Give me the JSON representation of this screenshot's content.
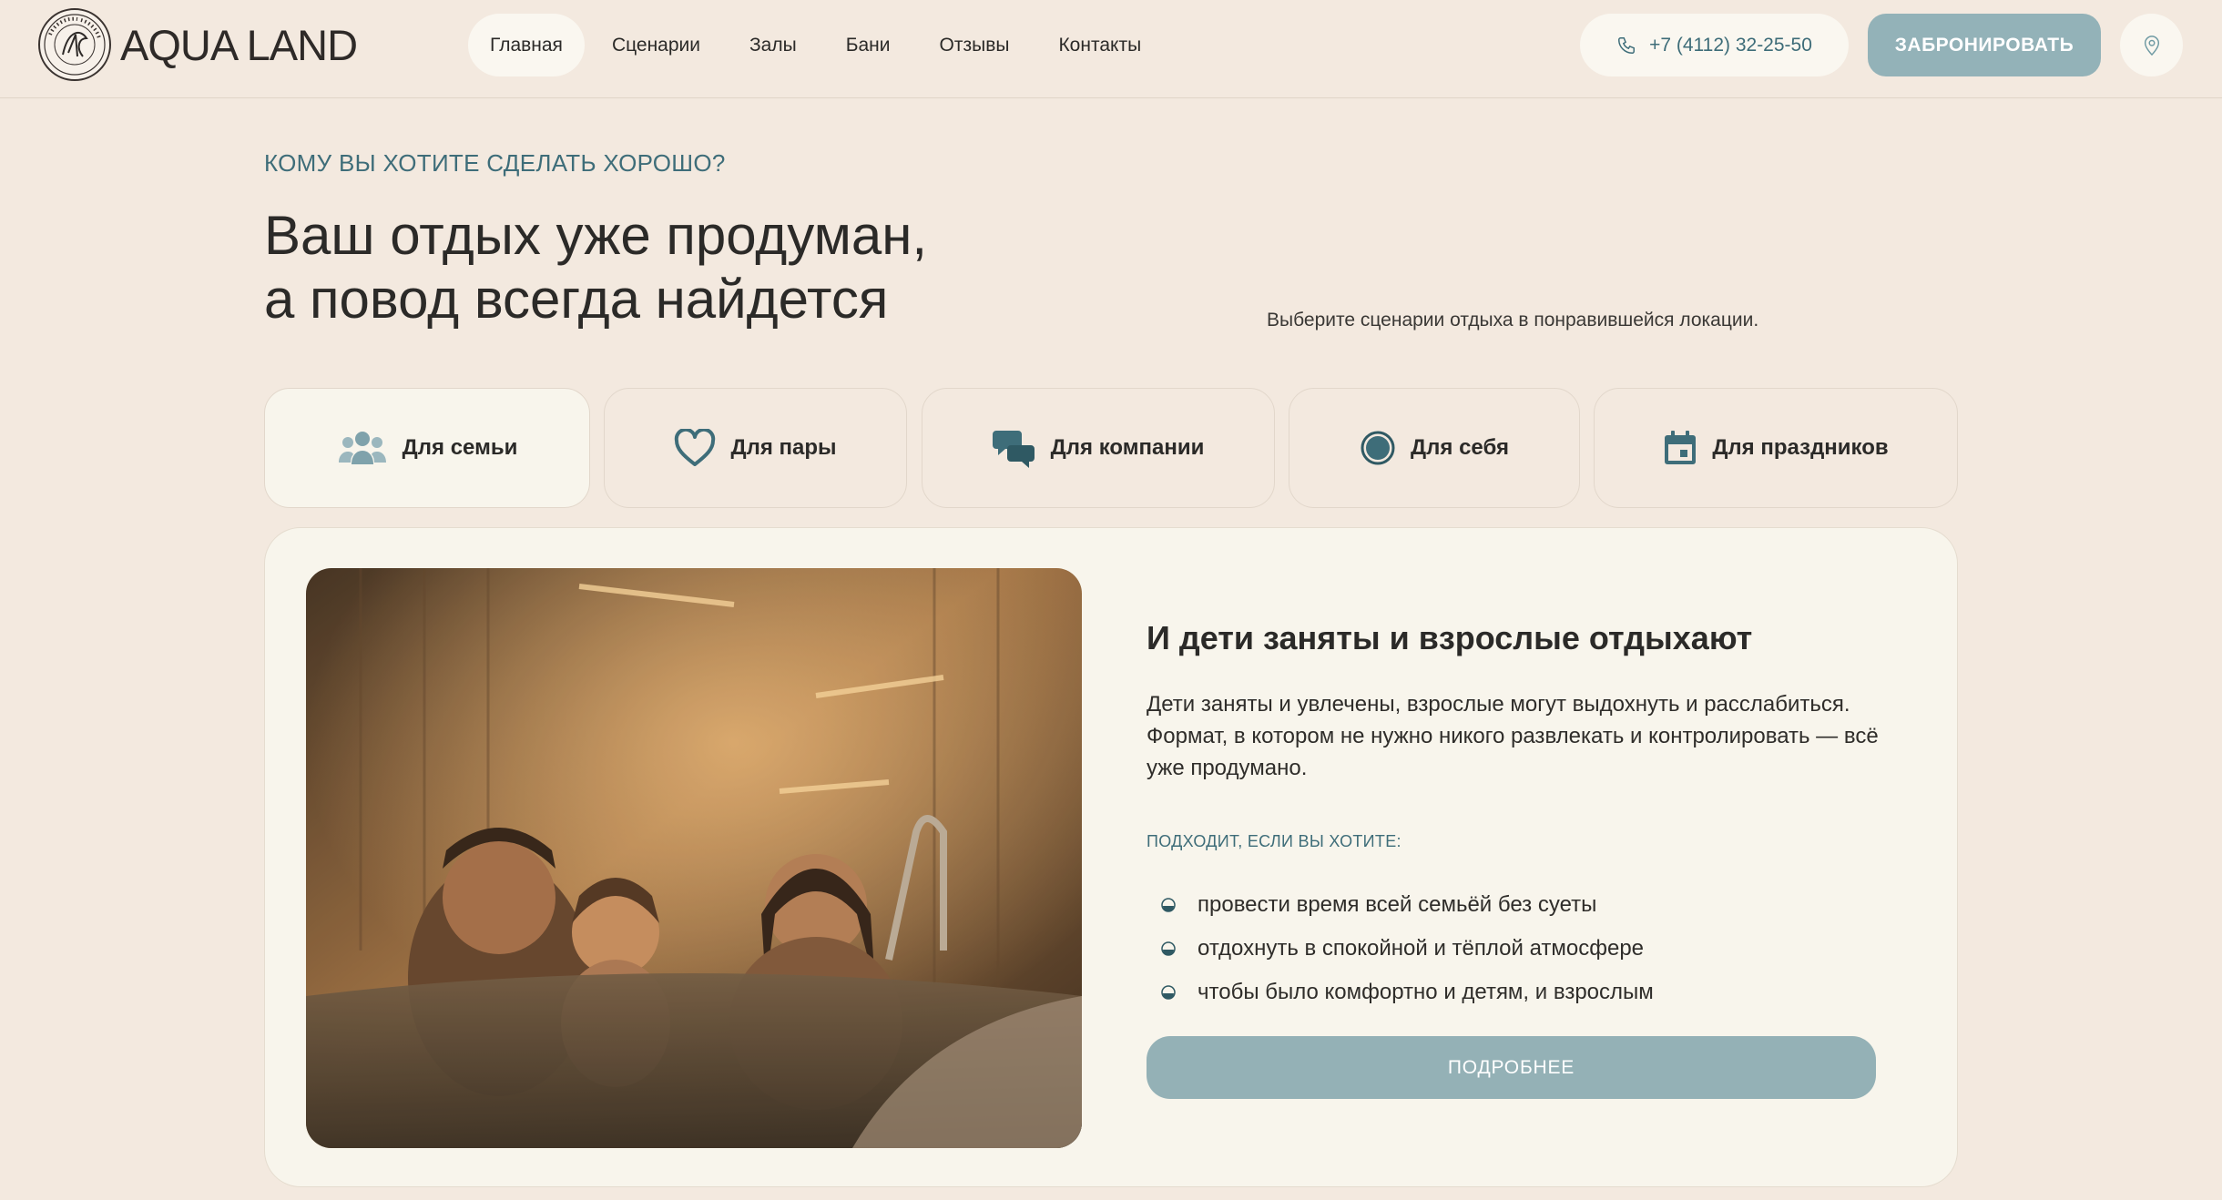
{
  "brand": {
    "name": "AQUA LAND",
    "logo_lettering": "ЦЕНТР ОТДЫХА"
  },
  "nav": {
    "items": [
      {
        "label": "Главная",
        "active": true
      },
      {
        "label": "Сценарии",
        "active": false
      },
      {
        "label": "Залы",
        "active": false
      },
      {
        "label": "Бани",
        "active": false
      },
      {
        "label": "Отзывы",
        "active": false
      },
      {
        "label": "Контакты",
        "active": false
      }
    ]
  },
  "header": {
    "phone": "+7 (4112) 32-25-50",
    "phone_icon": "phone-icon",
    "book_label": "ЗАБРОНИРОВАТЬ",
    "map_icon": "map-pin-icon"
  },
  "hero": {
    "eyebrow": "КОМУ ВЫ ХОТИТЕ СДЕЛАТЬ ХОРОШО?",
    "title_line1": "Ваш отдых уже продуман,",
    "title_line2": "а повод всегда найдется",
    "subtitle": "Выберите сценарии отдыха в понравившейся локации."
  },
  "tabs": [
    {
      "label": "Для семьи",
      "icon": "family-icon",
      "active": true
    },
    {
      "label": "Для пары",
      "icon": "heart-icon",
      "active": false
    },
    {
      "label": "Для компании",
      "icon": "chat-bubbles-icon",
      "active": false
    },
    {
      "label": "Для себя",
      "icon": "circle-icon",
      "active": false
    },
    {
      "label": "Для праздников",
      "icon": "calendar-icon",
      "active": false
    }
  ],
  "card": {
    "title": "И дети заняты и взрослые отдыхают",
    "text": "Дети заняты и увлечены, взрослые могут выдохнуть и расслабиться. Формат, в котором не нужно никого развлекать и контролировать — всё уже продумано.",
    "fits_label": "ПОДХОДИТ, ЕСЛИ ВЫ ХОТИТЕ:",
    "fits": [
      "провести время всей семьёй без суеты",
      "отдохнуть в спокойной и тёплой атмосфере",
      "чтобы было комфортно и детям, и взрослым"
    ],
    "button_label": "ПОДРОБНЕЕ",
    "photo": "family-in-hot-tub-photo"
  },
  "colors": {
    "background": "#f3e9df",
    "card": "#f8f5ec",
    "accent": "#3e6d79",
    "button": "#93b2b8",
    "text": "#2b2a28"
  }
}
